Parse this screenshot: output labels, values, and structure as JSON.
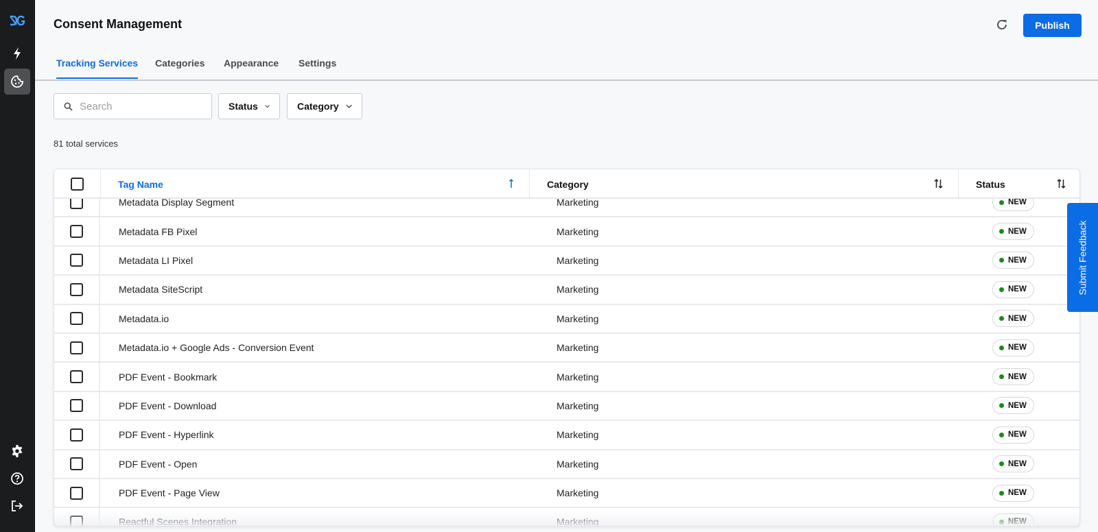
{
  "sidebar": {
    "logo": {
      "icon": "dg-logo-icon",
      "text": "DG",
      "color": "#4a9cf5"
    },
    "top_items": [
      {
        "name": "activity",
        "icon": "lightning-icon",
        "active": false
      },
      {
        "name": "consent",
        "icon": "cookie-icon",
        "active": true
      }
    ],
    "bottom_items": [
      {
        "name": "settings",
        "icon": "gear-icon"
      },
      {
        "name": "help",
        "icon": "help-circle-icon"
      },
      {
        "name": "logout",
        "icon": "logout-icon"
      }
    ]
  },
  "header": {
    "title": "Consent Management",
    "refresh_icon": "refresh-icon",
    "publish_label": "Publish"
  },
  "tabs": [
    {
      "label": "Tracking Services",
      "active": true
    },
    {
      "label": "Categories",
      "active": false
    },
    {
      "label": "Appearance",
      "active": false
    },
    {
      "label": "Settings",
      "active": false
    }
  ],
  "filters": {
    "search": {
      "placeholder": "Search",
      "value": "",
      "icon": "search-icon"
    },
    "status_label": "Status",
    "category_label": "Category"
  },
  "total_services": "81 total services",
  "table": {
    "columns": [
      {
        "label": "Tag Name",
        "sort": "ascending",
        "sort_icon": "arrow-up-icon"
      },
      {
        "label": "Category",
        "sort": "none",
        "sort_icon": "sort-both-icon"
      },
      {
        "label": "Status",
        "sort": "none",
        "sort_icon": "sort-both-icon"
      }
    ],
    "rows": [
      {
        "name": "Metadata Display Segment",
        "category": "Marketing",
        "status": "NEW"
      },
      {
        "name": "Metadata FB Pixel",
        "category": "Marketing",
        "status": "NEW"
      },
      {
        "name": "Metadata LI Pixel",
        "category": "Marketing",
        "status": "NEW"
      },
      {
        "name": "Metadata SiteScript",
        "category": "Marketing",
        "status": "NEW"
      },
      {
        "name": "Metadata.io",
        "category": "Marketing",
        "status": "NEW"
      },
      {
        "name": "Metadata.io + Google Ads - Conversion Event",
        "category": "Marketing",
        "status": "NEW"
      },
      {
        "name": "PDF Event - Bookmark",
        "category": "Marketing",
        "status": "NEW"
      },
      {
        "name": "PDF Event - Download",
        "category": "Marketing",
        "status": "NEW"
      },
      {
        "name": "PDF Event - Hyperlink",
        "category": "Marketing",
        "status": "NEW"
      },
      {
        "name": "PDF Event - Open",
        "category": "Marketing",
        "status": "NEW"
      },
      {
        "name": "PDF Event - Page View",
        "category": "Marketing",
        "status": "NEW"
      },
      {
        "name": "Reactful Scenes Integration",
        "category": "Marketing",
        "status": "NEW"
      }
    ]
  },
  "colors": {
    "accent": "#0b6de6",
    "status_new_dot": "#1a8a1a",
    "sidebar_bg": "#1b1c1e"
  },
  "feedback": {
    "label": "Submit Feedback"
  }
}
